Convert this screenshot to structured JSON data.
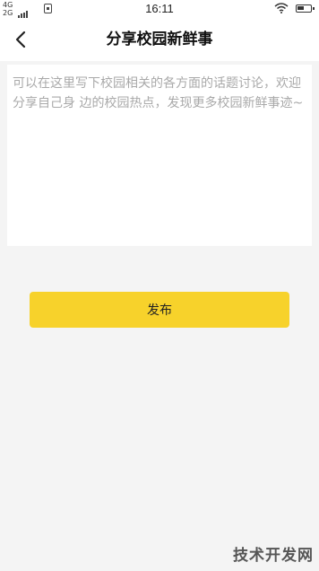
{
  "status_bar": {
    "network_top": "4G",
    "network_bottom": "2G",
    "time": "16:11"
  },
  "header": {
    "title": "分享校园新鲜事",
    "back_icon": "back-chevron-icon"
  },
  "post": {
    "value": "",
    "placeholder": "可以在这里写下校园相关的各方面的话题讨论，欢迎分享自己身 边的校园热点，发现更多校园新鲜事迹~"
  },
  "actions": {
    "publish_label": "发布"
  },
  "watermark": "技术开发网",
  "colors": {
    "accent": "#f7d22b",
    "background": "#f4f4f4",
    "surface": "#ffffff",
    "placeholder": "#a9a9a9"
  }
}
